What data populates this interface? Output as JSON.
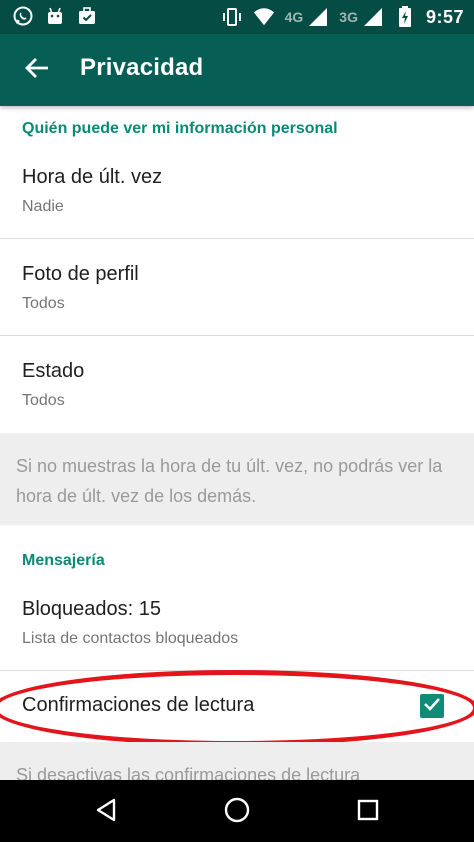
{
  "status_bar": {
    "time": "9:57",
    "network_4g": "4G",
    "network_3g": "3G",
    "icons": [
      "whatsapp-icon",
      "android-icon",
      "briefcase-icon",
      "vibrate-icon",
      "wifi-icon",
      "signal-icon",
      "signal-icon",
      "battery-charging-icon"
    ]
  },
  "app_bar": {
    "title": "Privacidad",
    "back_icon": "arrow-back-icon",
    "color": "#075e54"
  },
  "sections": {
    "personal_info": {
      "header": "Quién puede ver mi información personal",
      "items": [
        {
          "title": "Hora de últ. vez",
          "subtitle": "Nadie"
        },
        {
          "title": "Foto de perfil",
          "subtitle": "Todos"
        },
        {
          "title": "Estado",
          "subtitle": "Todos"
        }
      ],
      "note": "Si no muestras la hora de tu últ. vez, no podrás ver la hora de últ. vez de los demás."
    },
    "messaging": {
      "header": "Mensajería",
      "blocked": {
        "title": "Bloqueados: 15",
        "subtitle": "Lista de contactos bloqueados"
      },
      "read_receipts": {
        "title": "Confirmaciones de lectura",
        "checked": true
      },
      "note": "Si desactivas las confirmaciones de lectura"
    }
  },
  "nav_bar": {
    "icons": [
      "back-triangle-icon",
      "home-circle-icon",
      "recents-square-icon"
    ]
  },
  "colors": {
    "accent": "#0a8a76",
    "highlight_ellipse": "#e3151b"
  }
}
